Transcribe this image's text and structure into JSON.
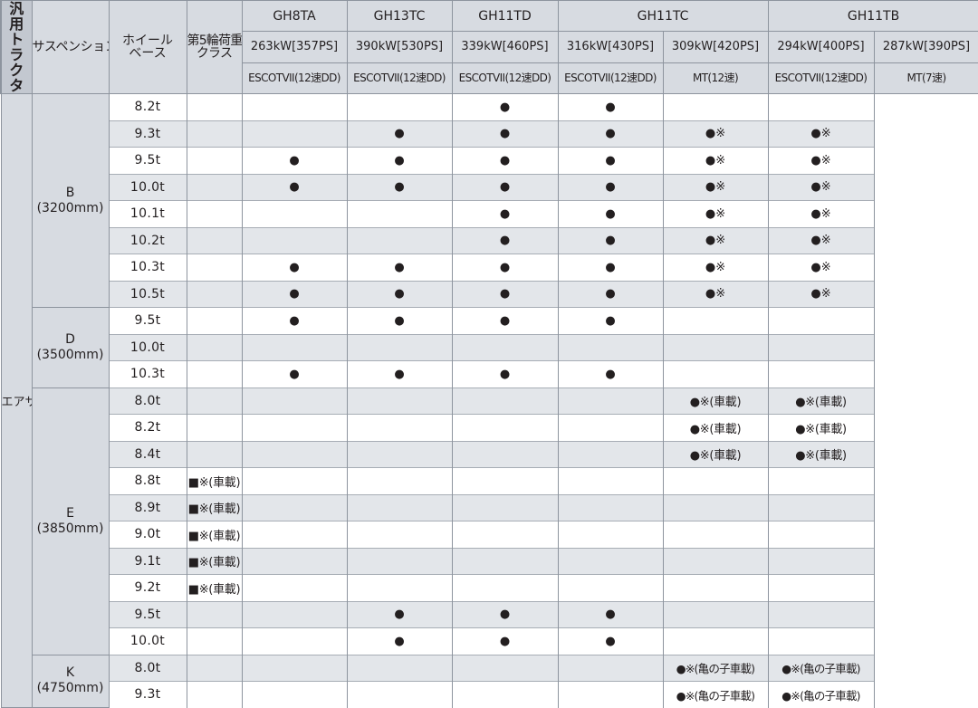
{
  "header": {
    "category": "汎用トラクタ",
    "suspension_label": "サスペンション",
    "wheelbase_label": [
      "ホイール",
      "ベース"
    ],
    "load_class_label": [
      "第5輪荷重",
      "クラス"
    ],
    "models": [
      "GH8TA",
      "GH13TC",
      "GH11TD",
      "GH11TC",
      "GH11TB"
    ],
    "outputs": [
      "263kW[357PS]",
      "390kW[530PS]",
      "339kW[460PS]",
      "316kW[430PS]",
      "309kW[420PS]",
      "294kW[400PS]",
      "287kW[390PS]"
    ],
    "transmissions": [
      "ESCOTVII(12速DD)",
      "ESCOTVII(12速DD)",
      "ESCOTVII(12速DD)",
      "ESCOTVII(12速DD)",
      "MT(12速)",
      "ESCOTVII(12速DD)",
      "MT(7速)"
    ]
  },
  "suspension": "エアサス",
  "groups": [
    {
      "label": "B",
      "mm": "(3200mm)",
      "rows": [
        {
          "load": "8.2t",
          "cells": [
            "",
            "",
            "",
            "●",
            "●",
            "",
            ""
          ]
        },
        {
          "load": "9.3t",
          "cells": [
            "",
            "",
            "●",
            "●",
            "●",
            "●※",
            "●※"
          ]
        },
        {
          "load": "9.5t",
          "cells": [
            "",
            "●",
            "●",
            "●",
            "●",
            "●※",
            "●※"
          ]
        },
        {
          "load": "10.0t",
          "cells": [
            "",
            "●",
            "●",
            "●",
            "●",
            "●※",
            "●※"
          ]
        },
        {
          "load": "10.1t",
          "cells": [
            "",
            "",
            "",
            "●",
            "●",
            "●※",
            "●※"
          ]
        },
        {
          "load": "10.2t",
          "cells": [
            "",
            "",
            "",
            "●",
            "●",
            "●※",
            "●※"
          ]
        },
        {
          "load": "10.3t",
          "cells": [
            "",
            "●",
            "●",
            "●",
            "●",
            "●※",
            "●※"
          ]
        },
        {
          "load": "10.5t",
          "cells": [
            "",
            "●",
            "●",
            "●",
            "●",
            "●※",
            "●※"
          ]
        }
      ]
    },
    {
      "label": "D",
      "mm": "(3500mm)",
      "rows": [
        {
          "load": "9.5t",
          "cells": [
            "",
            "●",
            "●",
            "●",
            "●",
            "",
            ""
          ]
        },
        {
          "load": "10.0t",
          "cells": [
            "",
            "",
            "",
            "",
            "",
            "",
            ""
          ]
        },
        {
          "load": "10.3t",
          "cells": [
            "",
            "●",
            "●",
            "●",
            "●",
            "",
            ""
          ]
        }
      ]
    },
    {
      "label": "E",
      "mm": "(3850mm)",
      "rows": [
        {
          "load": "8.0t",
          "cells": [
            "",
            "",
            "",
            "",
            "",
            "●※(車載)",
            "●※(車載)"
          ]
        },
        {
          "load": "8.2t",
          "cells": [
            "",
            "",
            "",
            "",
            "",
            "●※(車載)",
            "●※(車載)"
          ]
        },
        {
          "load": "8.4t",
          "cells": [
            "",
            "",
            "",
            "",
            "",
            "●※(車載)",
            "●※(車載)"
          ]
        },
        {
          "load": "8.8t",
          "cells": [
            "■※(車載)",
            "",
            "",
            "",
            "",
            "",
            ""
          ]
        },
        {
          "load": "8.9t",
          "cells": [
            "■※(車載)",
            "",
            "",
            "",
            "",
            "",
            ""
          ]
        },
        {
          "load": "9.0t",
          "cells": [
            "■※(車載)",
            "",
            "",
            "",
            "",
            "",
            ""
          ]
        },
        {
          "load": "9.1t",
          "cells": [
            "■※(車載)",
            "",
            "",
            "",
            "",
            "",
            ""
          ]
        },
        {
          "load": "9.2t",
          "cells": [
            "■※(車載)",
            "",
            "",
            "",
            "",
            "",
            ""
          ]
        },
        {
          "load": "9.5t",
          "cells": [
            "",
            "",
            "●",
            "●",
            "●",
            "",
            ""
          ]
        },
        {
          "load": "10.0t",
          "cells": [
            "",
            "",
            "●",
            "●",
            "●",
            "",
            ""
          ]
        }
      ]
    },
    {
      "label": "K",
      "mm": "(4750mm)",
      "rows": [
        {
          "load": "8.0t",
          "cells": [
            "",
            "",
            "",
            "",
            "",
            "●※(亀の子車載)",
            "●※(亀の子車載)"
          ]
        },
        {
          "load": "9.3t",
          "cells": [
            "",
            "",
            "",
            "",
            "",
            "●※(亀の子車載)",
            "●※(亀の子車載)"
          ]
        }
      ]
    }
  ]
}
